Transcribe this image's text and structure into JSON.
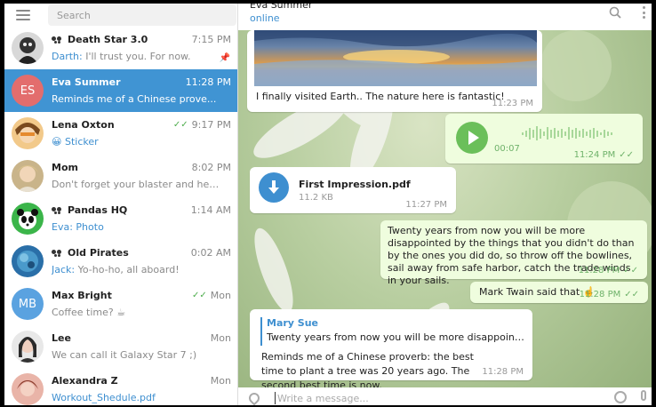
{
  "sidebar": {
    "search_placeholder": "Search",
    "chats": [
      {
        "name": "Death Star 3.0",
        "group": true,
        "time": "7:15 PM",
        "sender": "Darth:",
        "preview": "I'll trust you. For now.",
        "pinned": true
      },
      {
        "name": "Eva Summer",
        "initials": "ES",
        "time": "11:28 PM",
        "preview": "Reminds me of a Chinese prove...",
        "active": true
      },
      {
        "name": "Lena Oxton",
        "time": "9:17 PM",
        "read": true,
        "preview": "😀 Sticker"
      },
      {
        "name": "Mom",
        "time": "8:02 PM",
        "preview": "Don't forget your blaster and helmet"
      },
      {
        "name": "Pandas HQ",
        "group": true,
        "time": "1:14 AM",
        "sender": "Eva:",
        "preview": "Photo"
      },
      {
        "name": "Old Pirates",
        "group": true,
        "time": "0:02 AM",
        "sender": "Jack:",
        "preview": "Yo-ho-ho, all aboard!"
      },
      {
        "name": "Max Bright",
        "initials": "MB",
        "time": "Mon",
        "read": true,
        "preview": "Coffee time? ☕"
      },
      {
        "name": "Lee",
        "time": "Mon",
        "preview": "We can call it Galaxy Star 7 ;)"
      },
      {
        "name": "Alexandra Z",
        "time": "Mon",
        "preview": "Workout_Shedule.pdf"
      }
    ],
    "avatar_colors": {
      "es": "#e36d6d",
      "mb": "#5aa2e0"
    }
  },
  "chat": {
    "title": "Eva Summer",
    "status": "online",
    "messages": {
      "photo_caption": "I finally visited Earth.. The nature here is fantastic!",
      "photo_time": "11:23 PM",
      "voice_duration": "00:07",
      "voice_time": "11:24 PM",
      "file_name": "First Impression.pdf",
      "file_size": "11.2 KB",
      "file_time": "11:27 PM",
      "quote_text": "Twenty years from now you will be more disappointed by the things that you didn't do than by the ones you did do, so throw off the bowlines, sail away from safe harbor, catch the trade winds in your sails.",
      "quote_time": "11:28 PM",
      "twain_text": "Mark Twain said that ☝️",
      "twain_time": "11:28 PM",
      "reply_name": "Mary Sue",
      "reply_quote": "Twenty years from now you will be more disappointed by t...",
      "reply_text": "Reminds me of a Chinese proverb: the best time to plant a tree was 20 years ago. The second best time is now.",
      "reply_time": "11:28 PM"
    },
    "composer_placeholder": "Write a message..."
  },
  "colors": {
    "accent": "#4094d3",
    "outgoing": "#effdde",
    "read_check": "#4fae4e"
  }
}
